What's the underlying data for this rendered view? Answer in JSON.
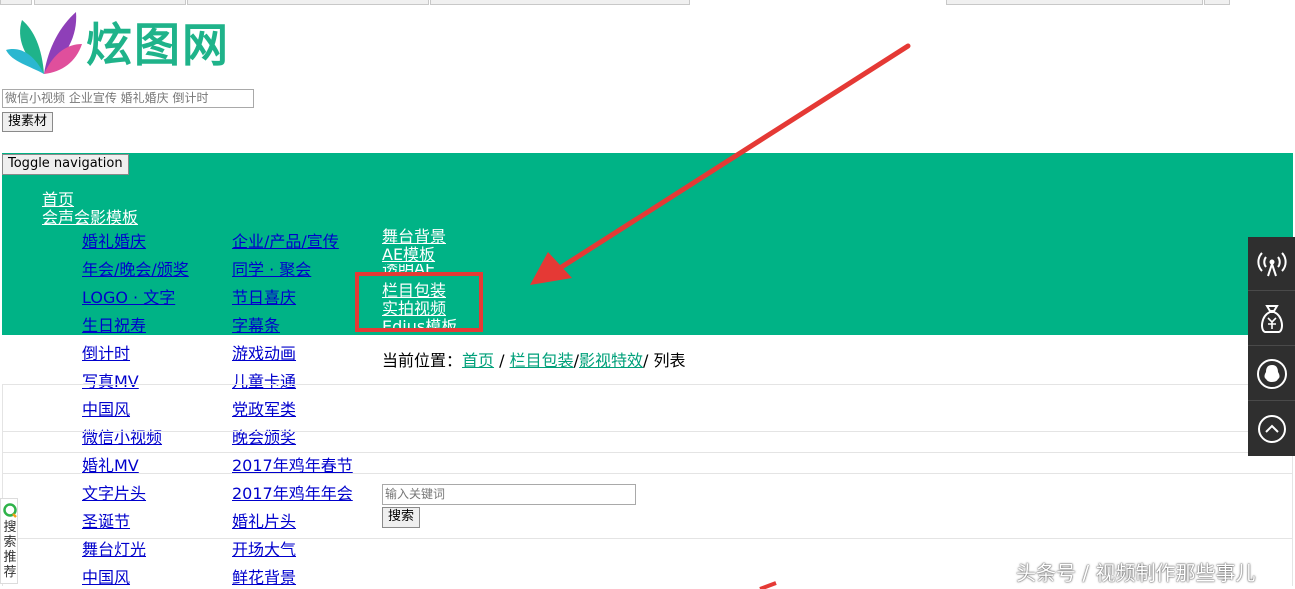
{
  "logo": {
    "text": "炫图网"
  },
  "top_search": {
    "placeholder": "微信小视频 企业宣传 婚礼婚庆 倒计时",
    "button": "搜素材"
  },
  "nav": {
    "toggle_label": "Toggle navigation",
    "home": "首页",
    "parent": "会声会影模板",
    "col1": [
      "婚礼婚庆",
      "年会/晚会/颁奖",
      "LOGO · 文字",
      "生日祝寿",
      "倒计时",
      "写真MV",
      "中国风",
      "微信小视频",
      "婚礼MV",
      "文字片头",
      "圣诞节",
      "舞台灯光",
      "中国风"
    ],
    "col2": [
      "企业/产品/宣传",
      "同学 · 聚会",
      "节日喜庆",
      "字幕条",
      "游戏动画",
      "儿童卡通",
      "党政军类",
      "晚会颁奖",
      "2017年鸡年春节",
      "2017年鸡年年会",
      "婚礼片头",
      "开场大气",
      "鲜花背景"
    ],
    "col3": [
      "舞台背景",
      "AE模板",
      "透明AE",
      "栏目包装",
      "实拍视频",
      "Edius模板"
    ]
  },
  "breadcrumb": {
    "prefix": "当前位置：",
    "home": "首页",
    "sep1": " / ",
    "level2": "栏目包装",
    "sep2": "/",
    "level3": "影视特效",
    "suffix": "/ 列表"
  },
  "keyword_search": {
    "placeholder": "输入关键词",
    "button": "搜索"
  },
  "left_widget": {
    "label": "搜索推荐"
  },
  "sidebar_icons": [
    "broadcast-icon",
    "money-bag-icon",
    "qq-icon",
    "back-to-top-icon"
  ],
  "watermark": "头条号 / 视频制作那些事儿",
  "colors": {
    "nav_bg": "#00b386",
    "annotation": "#e53935",
    "brand": "#1fb38a"
  }
}
